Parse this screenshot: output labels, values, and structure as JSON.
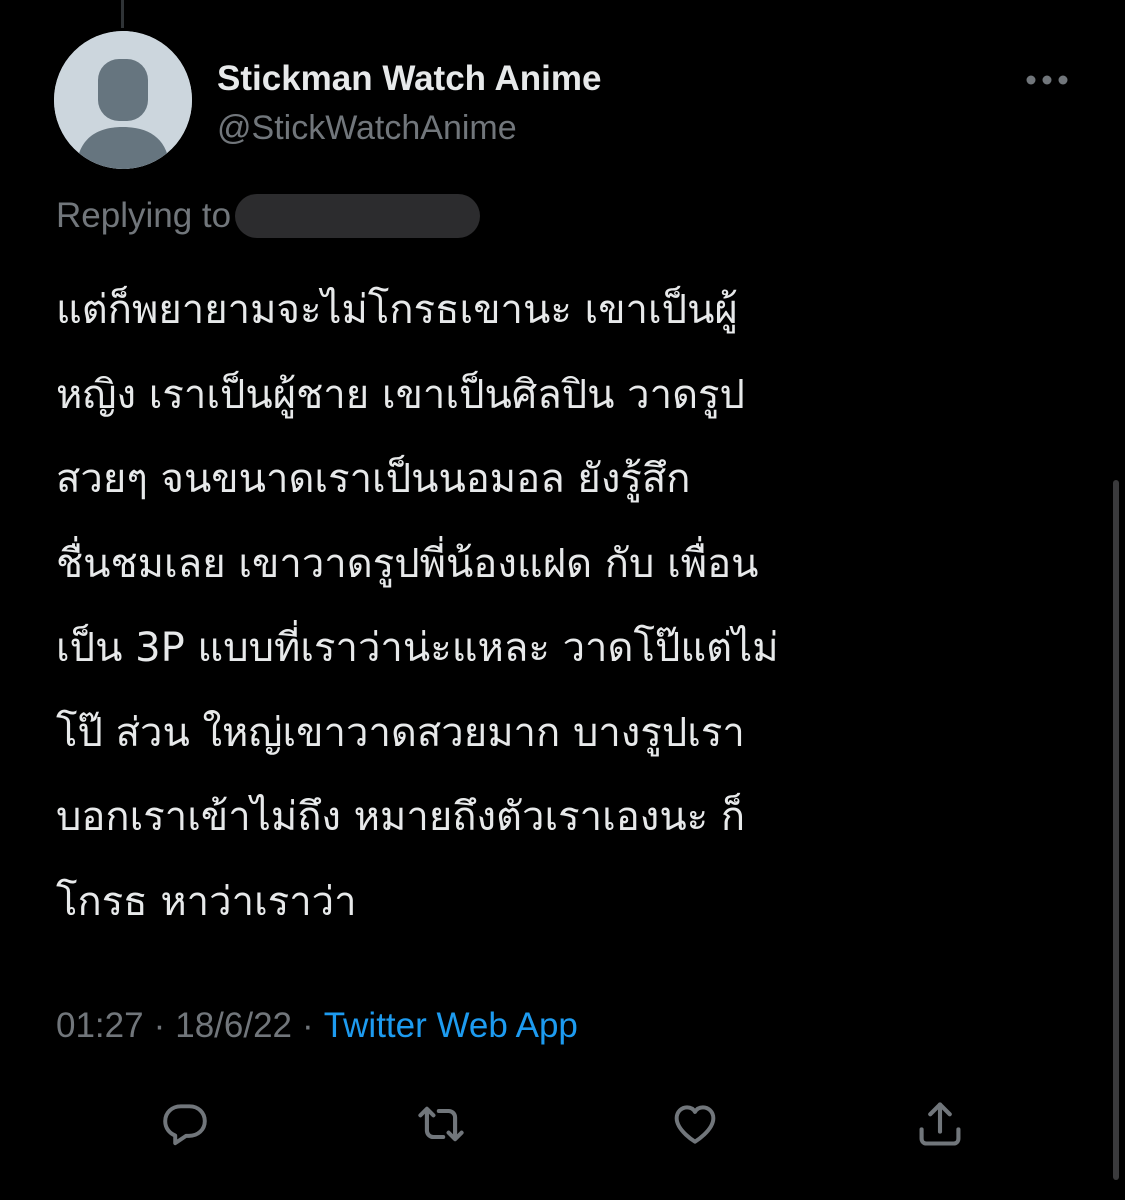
{
  "tweet": {
    "author": {
      "display_name": "Stickman Watch Anime",
      "handle": "@StickWatchAnime",
      "avatar_icon": "default-avatar-icon"
    },
    "replying_to_label": "Replying to",
    "text_lines": [
      "แต่ก็พยายามจะไม่โกรธเขานะ เขาเป็นผู้",
      "หญิง เราเป็นผู้ชาย เขาเป็นศิลปิน วาดรูป",
      "สวยๆ จนขนาดเราเป็นนอมอล ยังรู้สึก",
      "ชื่นชมเลย เขาวาดรูปพี่น้องแฝด กับ เพื่อน",
      "เป็น 3P แบบที่เราว่าน่ะแหละ วาดโป๊แต่ไม่",
      "โป๊ ส่วน ใหญ่เขาวาดสวยมาก บางรูปเรา",
      "บอกเราเข้าไม่ถึง หมายถึงตัวเราเองนะ ก็",
      "โกรธ หาว่าเราว่า"
    ],
    "time": "01:27",
    "separator": "·",
    "date": "18/6/22",
    "source": "Twitter Web App"
  },
  "actions": [
    {
      "name": "reply-button",
      "icon": "reply-icon"
    },
    {
      "name": "retweet-button",
      "icon": "retweet-icon"
    },
    {
      "name": "like-button",
      "icon": "like-icon"
    },
    {
      "name": "share-button",
      "icon": "share-icon"
    }
  ],
  "colors": {
    "background": "#000000",
    "text_primary": "#e7e9ea",
    "text_secondary": "#71767b",
    "link_accent": "#1d9bf0",
    "avatar_bg": "#ccd6dd",
    "avatar_figure": "#66757f"
  }
}
